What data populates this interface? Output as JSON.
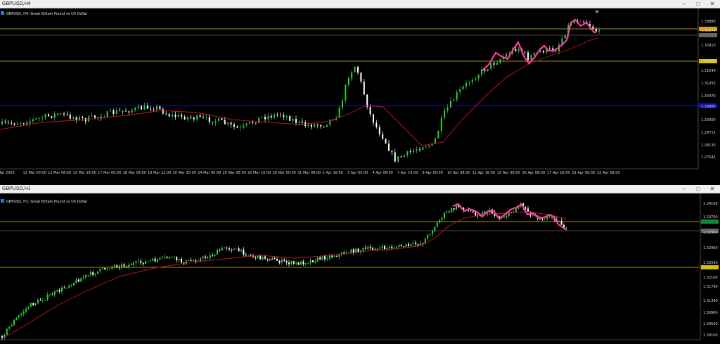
{
  "window1": {
    "title": "GBPUSD,H4",
    "info": "GBPUSD, H4:  Great Britain Pound vs US Dollar",
    "price_labels": [
      "1.33880",
      "1.32870",
      "1.32910",
      "1.32063",
      "1.31640",
      "1.31055",
      "1.30470",
      "1.29885",
      "1.29300",
      "1.28715",
      "1.28130",
      "1.27545"
    ],
    "time_labels": [
      "Mar 2025",
      "11 Mar 00:00",
      "12 Mar 08:00",
      "13 Mar 16:00",
      "17 Mar 00:00",
      "18 Mar 08:00",
      "19 Mar 12:00",
      "20 Mar 20:00",
      "24 Mar 00:00",
      "25 Mar 08:00",
      "26 Mar 16:00",
      "28 Mar 00:00",
      "31 Mar 08:00",
      "1 Apr 16:00",
      "3 Apr 00:00",
      "4 Apr 08:00",
      "7 Apr 16:00",
      "9 Apr 00:00",
      "10 Apr 08:00",
      "11 Apr 16:00",
      "15 Apr 00:00",
      "16 Apr 08:00",
      "17 Apr 16:00",
      "21 Apr 00:00",
      "22 Apr 08:00"
    ]
  },
  "window2": {
    "title": "GBPUSD,H1",
    "info": "GBPUSD, H1:  Great Britain Pound vs US Dollar",
    "price_labels": [
      "1.34160",
      "1.33760",
      "1.33360",
      "1.32960",
      "1.32560",
      "1.32160",
      "1.31760",
      "1.31360",
      "1.30960",
      "1.30560",
      "1.30160"
    ],
    "time_labels": [
      "",
      "",
      "",
      "",
      "",
      "",
      "",
      "",
      "",
      "",
      "",
      "",
      "",
      "",
      "",
      "",
      "",
      "",
      "",
      "",
      "",
      "",
      "",
      "",
      "",
      "",
      "",
      "",
      "",
      "",
      "",
      "",
      "",
      "",
      "",
      "",
      ""
    ]
  },
  "colors": {
    "bull": "#2ecc40",
    "bear": "#ffffff",
    "ma": "#c0181f",
    "pattern": "#ff3ca5",
    "hline": "#d4c000",
    "blueline": "#1010c8",
    "bg": "#000000"
  },
  "icons": {
    "window_icon": "chart-icon",
    "minimize": "minimize-icon",
    "maximize": "maximize-icon",
    "close": "close-icon"
  }
}
